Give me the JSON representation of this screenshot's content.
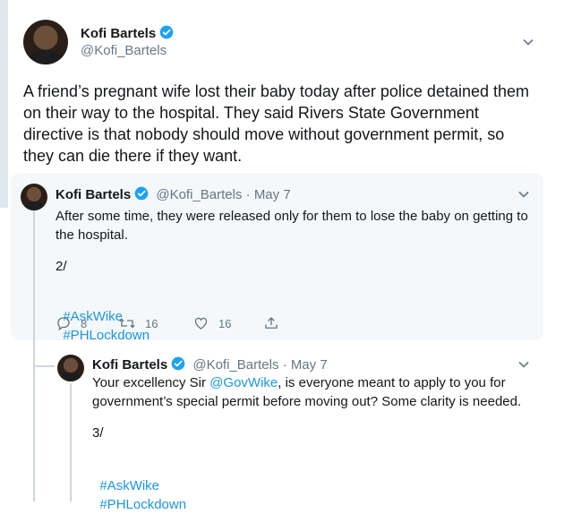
{
  "main_tweet": {
    "author_name": "Kofi Bartels",
    "handle": "@Kofi_Bartels",
    "text": "A friend’s pregnant wife lost their baby today after police detained them on their way to the hospital. They said Rivers State Government directive is that nobody should move without government permit, so they can die there if they want."
  },
  "replies": [
    {
      "author_name": "Kofi Bartels",
      "handle": "@Kofi_Bartels",
      "separator": "·",
      "date": "May 7",
      "text": "After some time, they were released only for them to lose the baby on getting to the hospital.",
      "counter": "2/",
      "hashtags": [
        "#AskWike",
        "#PHLockdown"
      ],
      "actions": {
        "replies": "8",
        "retweets": "16",
        "likes": "16"
      }
    },
    {
      "author_name": "Kofi Bartels",
      "handle": "@Kofi_Bartels",
      "separator": "·",
      "date": "May 7",
      "text_prefix": "Your excellency Sir ",
      "mention": "@GovWike",
      "text_suffix": ", is everyone meant to apply to you for government’s special permit before moving out? Some clarity is needed.",
      "counter": "3/",
      "hashtags": [
        "#AskWike",
        "#PHLockdown"
      ]
    }
  ],
  "colors": {
    "accent": "#1da1f2",
    "link": "#1b95e0",
    "muted": "#657786",
    "reply_bg": "#f5f8fa"
  }
}
